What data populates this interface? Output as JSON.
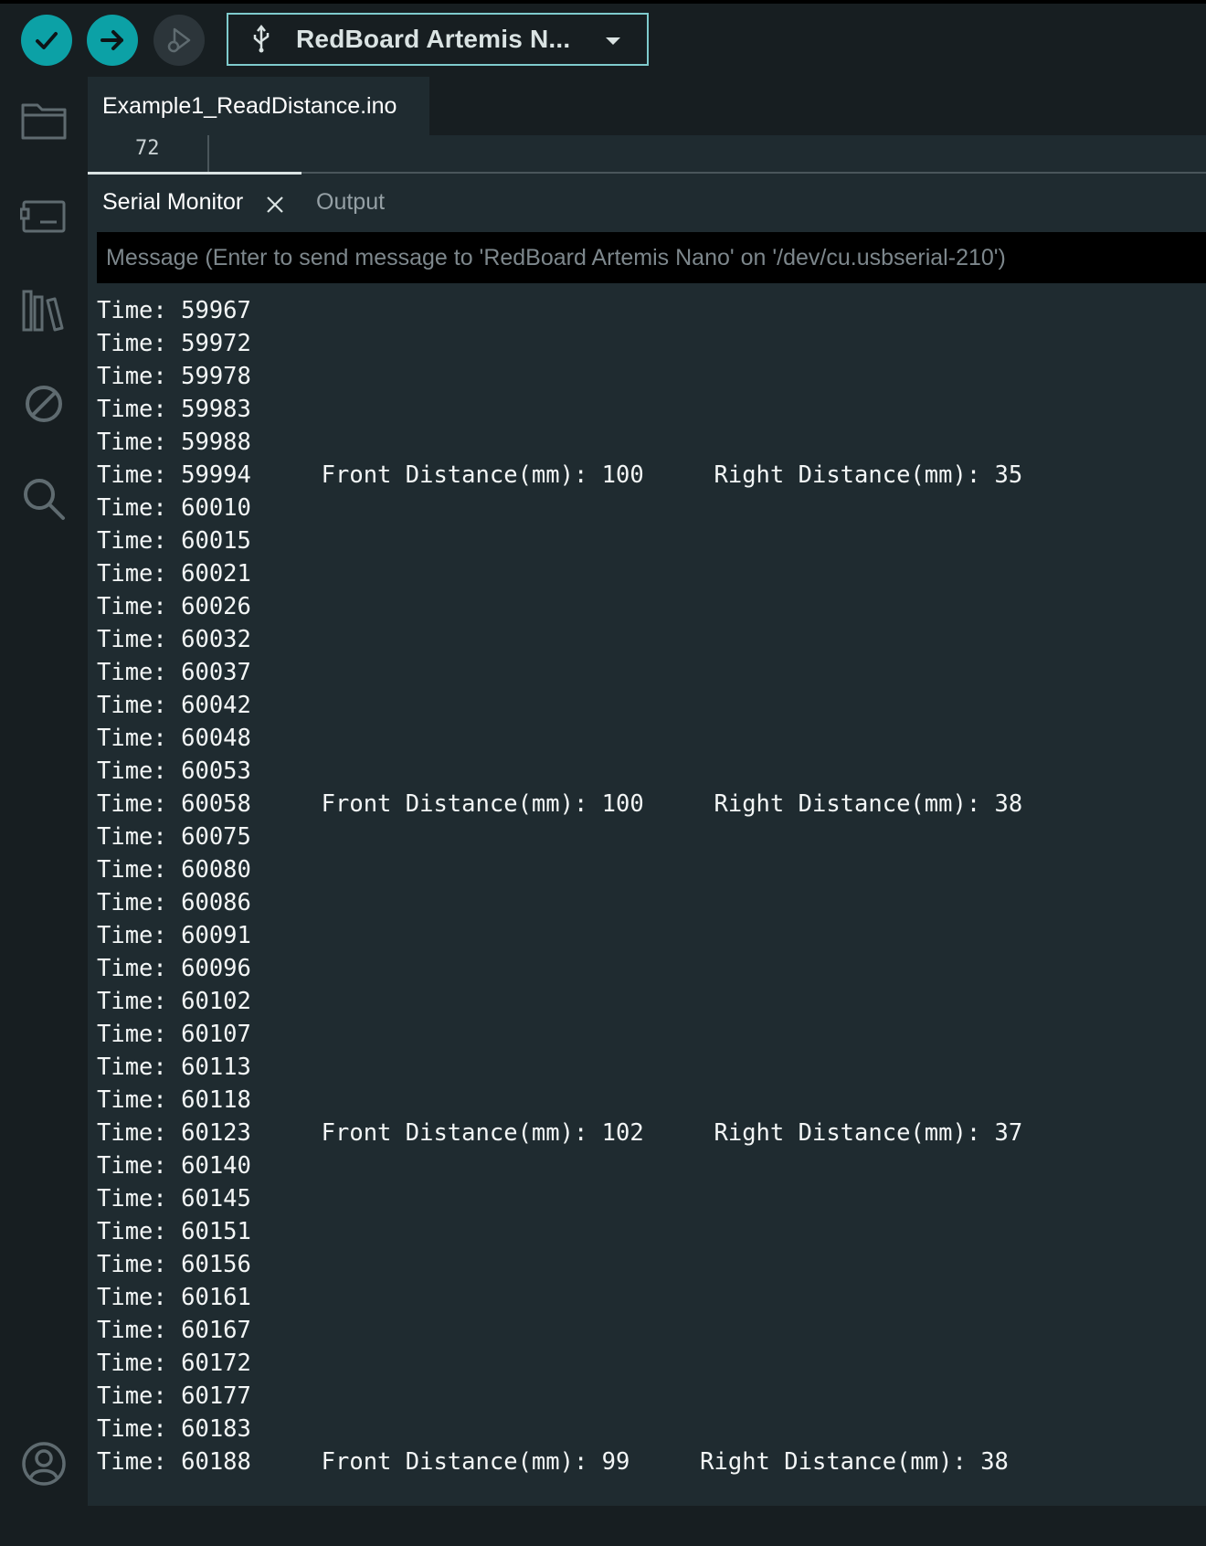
{
  "toolbar": {
    "verify_icon": "checkmark-icon",
    "upload_icon": "arrow-right-icon",
    "debug_icon": "debug-icon",
    "board_name": "RedBoard Artemis N...",
    "accent_color": "#0ca1a6"
  },
  "sidebar": {
    "items": [
      {
        "icon": "folder-icon"
      },
      {
        "icon": "board-manager-icon"
      },
      {
        "icon": "library-icon"
      },
      {
        "icon": "no-debug-icon"
      },
      {
        "icon": "search-icon"
      },
      {
        "icon": "account-icon"
      }
    ]
  },
  "editor": {
    "file_tab": "Example1_ReadDistance.ino",
    "line_number": "72"
  },
  "panel": {
    "tabs": [
      {
        "label": "Serial Monitor",
        "active": true
      },
      {
        "label": "Output",
        "active": false
      }
    ],
    "message_placeholder": "Message (Enter to send message to 'RedBoard Artemis Nano' on '/dev/cu.usbserial-210')",
    "serial_lines": [
      "Time: 59967",
      "Time: 59972",
      "Time: 59978",
      "Time: 59983",
      "Time: 59988",
      "Time: 59994     Front Distance(mm): 100     Right Distance(mm): 35",
      "Time: 60010",
      "Time: 60015",
      "Time: 60021",
      "Time: 60026",
      "Time: 60032",
      "Time: 60037",
      "Time: 60042",
      "Time: 60048",
      "Time: 60053",
      "Time: 60058     Front Distance(mm): 100     Right Distance(mm): 38",
      "Time: 60075",
      "Time: 60080",
      "Time: 60086",
      "Time: 60091",
      "Time: 60096",
      "Time: 60102",
      "Time: 60107",
      "Time: 60113",
      "Time: 60118",
      "Time: 60123     Front Distance(mm): 102     Right Distance(mm): 37",
      "Time: 60140",
      "Time: 60145",
      "Time: 60151",
      "Time: 60156",
      "Time: 60161",
      "Time: 60167",
      "Time: 60172",
      "Time: 60177",
      "Time: 60183",
      "Time: 60188     Front Distance(mm): 99     Right Distance(mm): 38"
    ]
  }
}
